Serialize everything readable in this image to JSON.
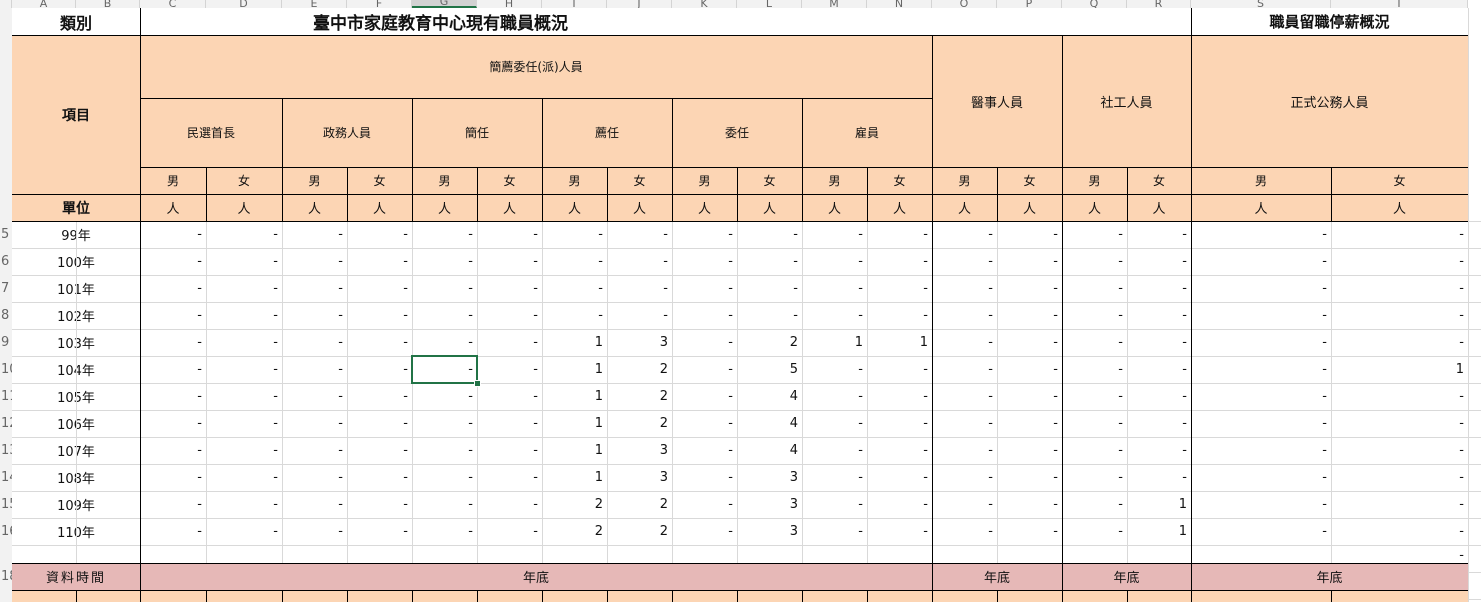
{
  "column_letters": [
    "A",
    "B",
    "C",
    "D",
    "E",
    "F",
    "G",
    "H",
    "I",
    "J",
    "K",
    "L",
    "M",
    "N",
    "O",
    "P",
    "Q",
    "R",
    "S",
    "T"
  ],
  "row_numbers": [
    "5",
    "6",
    "7",
    "8",
    "9",
    "10",
    "11",
    "12",
    "13",
    "14",
    "15",
    "16",
    "18"
  ],
  "header": {
    "category_label": "類別",
    "main_title": "臺中市家庭教育中心現有職員概況",
    "side_title": "職員留職停薪概況",
    "item_label": "項目",
    "unit_label": "單位",
    "group_appointed": "簡薦委任(派)人員",
    "group_medical": "醫事人員",
    "group_social": "社工人員",
    "group_civil": "正式公務人員",
    "sub_groups": [
      "民選首長",
      "政務人員",
      "簡任",
      "薦任",
      "委任",
      "雇員"
    ],
    "male": "男",
    "female": "女",
    "unit": "人"
  },
  "rows": [
    {
      "year": "99年",
      "values": [
        "-",
        "-",
        "-",
        "-",
        "-",
        "-",
        "-",
        "-",
        "-",
        "-",
        "-",
        "-",
        "-",
        "-",
        "-",
        "-",
        "-",
        "-"
      ]
    },
    {
      "year": "100年",
      "values": [
        "-",
        "-",
        "-",
        "-",
        "-",
        "-",
        "-",
        "-",
        "-",
        "-",
        "-",
        "-",
        "-",
        "-",
        "-",
        "-",
        "-",
        "-"
      ]
    },
    {
      "year": "101年",
      "values": [
        "-",
        "-",
        "-",
        "-",
        "-",
        "-",
        "-",
        "-",
        "-",
        "-",
        "-",
        "-",
        "-",
        "-",
        "-",
        "-",
        "-",
        "-"
      ]
    },
    {
      "year": "102年",
      "values": [
        "-",
        "-",
        "-",
        "-",
        "-",
        "-",
        "-",
        "-",
        "-",
        "-",
        "-",
        "-",
        "-",
        "-",
        "-",
        "-",
        "-",
        "-"
      ]
    },
    {
      "year": "103年",
      "values": [
        "-",
        "-",
        "-",
        "-",
        "-",
        "-",
        "1",
        "3",
        "-",
        "2",
        "1",
        "1",
        "-",
        "-",
        "-",
        "-",
        "-",
        "-"
      ]
    },
    {
      "year": "104年",
      "values": [
        "-",
        "-",
        "-",
        "-",
        "-",
        "-",
        "1",
        "2",
        "-",
        "5",
        "-",
        "-",
        "-",
        "-",
        "-",
        "-",
        "-",
        "1"
      ]
    },
    {
      "year": "105年",
      "values": [
        "-",
        "-",
        "-",
        "-",
        "-",
        "-",
        "1",
        "2",
        "-",
        "4",
        "-",
        "-",
        "-",
        "-",
        "-",
        "-",
        "-",
        "-"
      ]
    },
    {
      "year": "106年",
      "values": [
        "-",
        "-",
        "-",
        "-",
        "-",
        "-",
        "1",
        "2",
        "-",
        "4",
        "-",
        "-",
        "-",
        "-",
        "-",
        "-",
        "-",
        "-"
      ]
    },
    {
      "year": "107年",
      "values": [
        "-",
        "-",
        "-",
        "-",
        "-",
        "-",
        "1",
        "3",
        "-",
        "4",
        "-",
        "-",
        "-",
        "-",
        "-",
        "-",
        "-",
        "-"
      ]
    },
    {
      "year": "108年",
      "values": [
        "-",
        "-",
        "-",
        "-",
        "-",
        "-",
        "1",
        "3",
        "-",
        "3",
        "-",
        "-",
        "-",
        "-",
        "-",
        "-",
        "-",
        "-"
      ]
    },
    {
      "year": "109年",
      "values": [
        "-",
        "-",
        "-",
        "-",
        "-",
        "-",
        "2",
        "2",
        "-",
        "3",
        "-",
        "-",
        "-",
        "-",
        "-",
        "1",
        "-",
        "-"
      ]
    },
    {
      "year": "110年",
      "values": [
        "-",
        "-",
        "-",
        "-",
        "-",
        "-",
        "2",
        "2",
        "-",
        "3",
        "-",
        "-",
        "-",
        "-",
        "-",
        "1",
        "-",
        "-"
      ]
    }
  ],
  "trailing_dash": "-",
  "footer": {
    "label": "資料時間",
    "value_appointed": "年底",
    "value_medical": "年底",
    "value_social": "年底",
    "value_civil": "年底"
  }
}
